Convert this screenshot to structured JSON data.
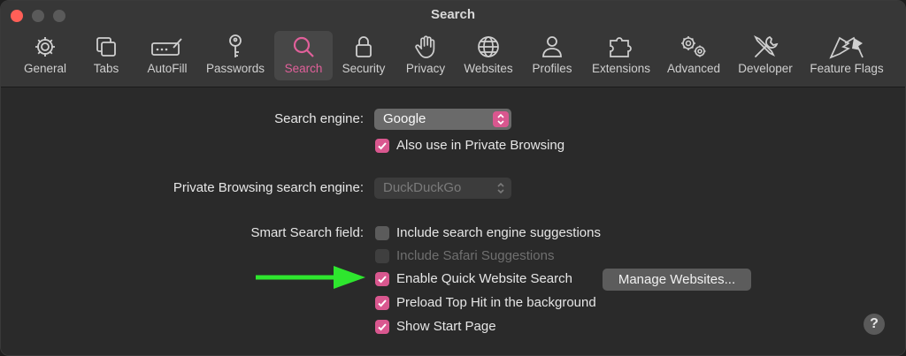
{
  "window": {
    "title": "Search"
  },
  "toolbar": {
    "items": [
      {
        "label": "General",
        "icon": "gear-icon"
      },
      {
        "label": "Tabs",
        "icon": "tabs-icon"
      },
      {
        "label": "AutoFill",
        "icon": "autofill-icon"
      },
      {
        "label": "Passwords",
        "icon": "key-icon"
      },
      {
        "label": "Search",
        "icon": "magnifier-icon",
        "selected": true
      },
      {
        "label": "Security",
        "icon": "lock-icon"
      },
      {
        "label": "Privacy",
        "icon": "hand-icon"
      },
      {
        "label": "Websites",
        "icon": "globe-icon"
      },
      {
        "label": "Profiles",
        "icon": "person-icon"
      },
      {
        "label": "Extensions",
        "icon": "puzzle-icon"
      },
      {
        "label": "Advanced",
        "icon": "gears-icon"
      },
      {
        "label": "Developer",
        "icon": "wrench-icon"
      },
      {
        "label": "Feature Flags",
        "icon": "flags-icon"
      }
    ]
  },
  "settings": {
    "search_engine": {
      "label": "Search engine:",
      "value": "Google"
    },
    "private_also": {
      "label": "Also use in Private Browsing",
      "checked": true
    },
    "private_engine": {
      "label": "Private Browsing search engine:",
      "value": "DuckDuckGo",
      "enabled": false
    },
    "smart_search": {
      "label": "Smart Search field:"
    },
    "options": [
      {
        "label": "Include search engine suggestions",
        "checked": false,
        "enabled": true
      },
      {
        "label": "Include Safari Suggestions",
        "checked": false,
        "enabled": false
      },
      {
        "label": "Enable Quick Website Search",
        "checked": true,
        "enabled": true
      },
      {
        "label": "Preload Top Hit in the background",
        "checked": true,
        "enabled": true
      },
      {
        "label": "Show Start Page",
        "checked": true,
        "enabled": true
      }
    ],
    "manage_websites": "Manage Websites..."
  },
  "help": {
    "label": "?"
  },
  "colors": {
    "accent": "#d9578f",
    "annotation_arrow": "#2ee62e"
  }
}
